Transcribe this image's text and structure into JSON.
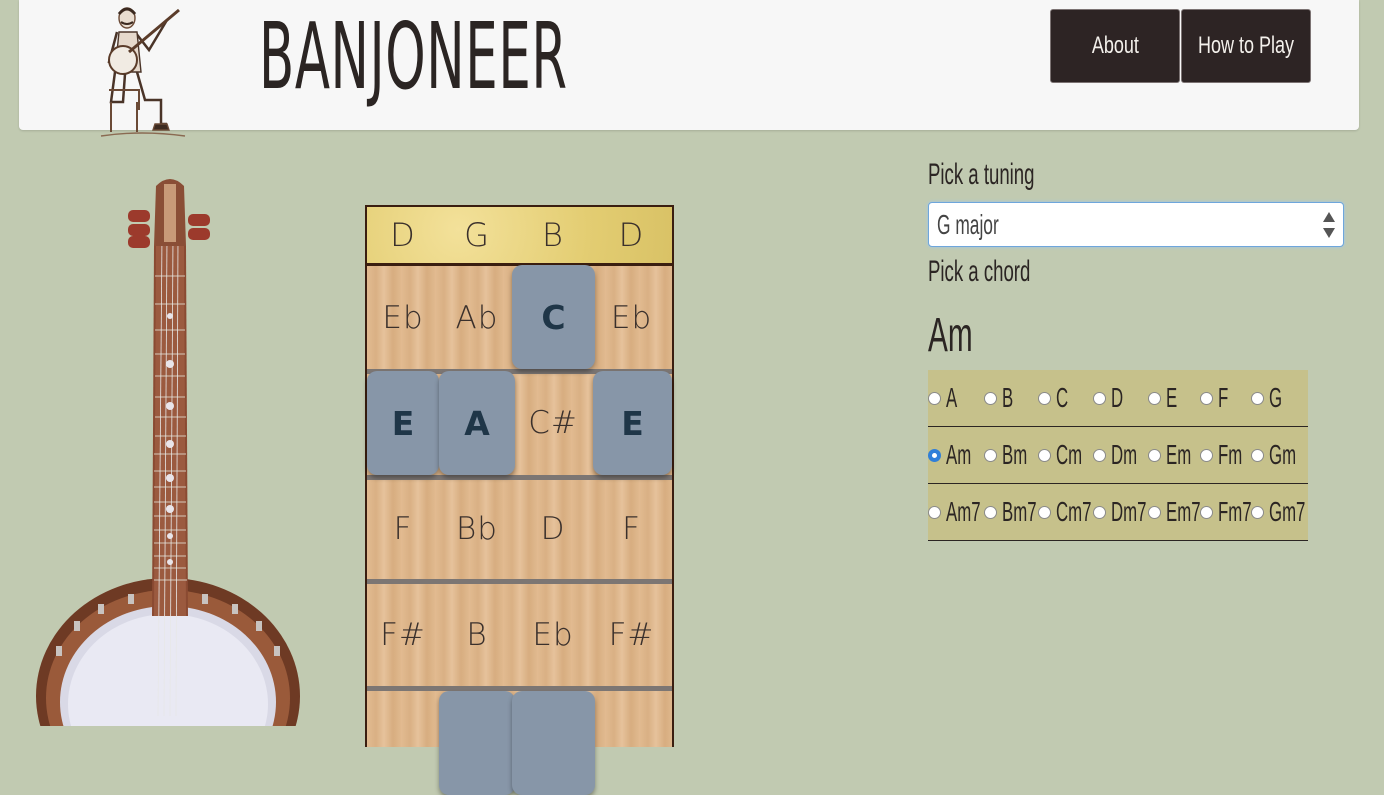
{
  "header": {
    "brand": "BANJONEER",
    "nav": [
      {
        "label": "About"
      },
      {
        "label": "How to Play"
      }
    ]
  },
  "fretboard": {
    "open_strings": [
      "D",
      "G",
      "B",
      "D"
    ],
    "frets": [
      [
        "Eb",
        "Ab",
        "C",
        "Eb"
      ],
      [
        "E",
        "A",
        "C#",
        "E"
      ],
      [
        "F",
        "Bb",
        "D",
        "F"
      ],
      [
        "F#",
        "B",
        "Eb",
        "F#"
      ],
      [
        "",
        "",
        "",
        ""
      ]
    ],
    "highlighted": [
      [
        0,
        2
      ],
      [
        1,
        0
      ],
      [
        1,
        1
      ],
      [
        1,
        3
      ],
      [
        4,
        1
      ],
      [
        4,
        2
      ]
    ]
  },
  "controls": {
    "tuning_label": "Pick a tuning",
    "tuning_value": "G major",
    "chord_label": "Pick a chord",
    "selected_chord": "Am",
    "chord_rows": [
      [
        "A",
        "B",
        "C",
        "D",
        "E",
        "F",
        "G"
      ],
      [
        "Am",
        "Bm",
        "Cm",
        "Dm",
        "Em",
        "Fm",
        "Gm"
      ],
      [
        "Am7",
        "Bm7",
        "Cm7",
        "Dm7",
        "Em7",
        "Fm7",
        "Gm7"
      ]
    ]
  },
  "colors": {
    "background": "#c1cab1",
    "highlight": "#8796a8",
    "chord_table": "#c6c18b"
  }
}
